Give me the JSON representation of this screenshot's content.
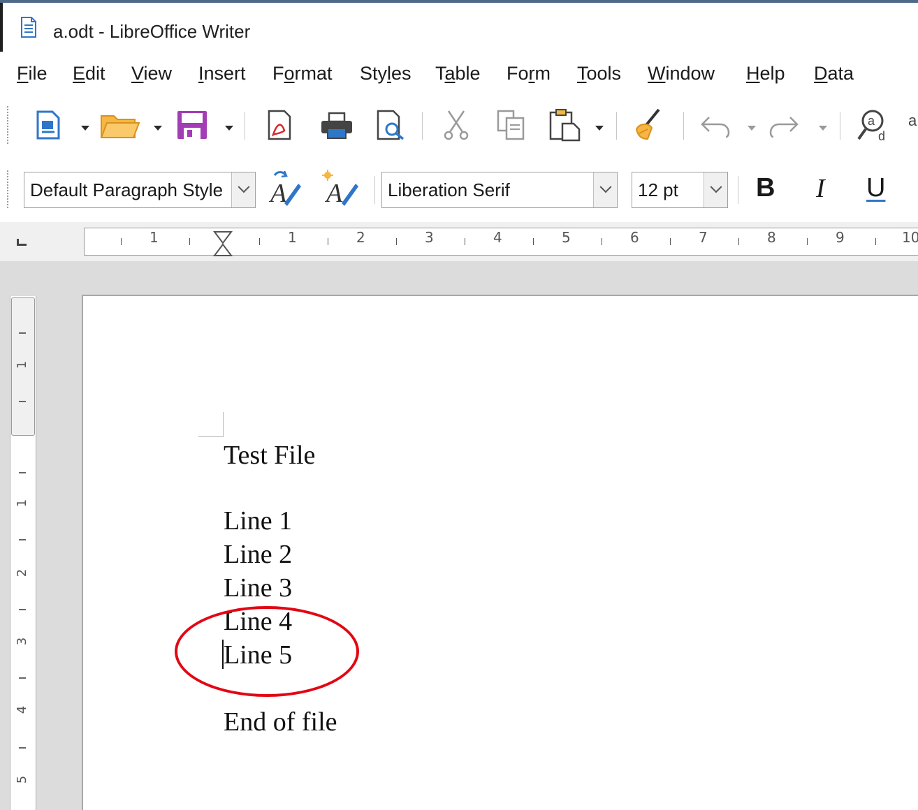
{
  "window": {
    "title": "a.odt - LibreOffice Writer",
    "icon": "writer-document-icon"
  },
  "menubar": {
    "items": [
      {
        "mnemonic": "F",
        "rest": "ile"
      },
      {
        "mnemonic": "E",
        "rest": "dit"
      },
      {
        "mnemonic": "V",
        "rest": "iew"
      },
      {
        "mnemonic": "I",
        "rest": "nsert"
      },
      {
        "pre": "F",
        "mnemonic": "o",
        "rest": "rmat"
      },
      {
        "pre": "Sty",
        "mnemonic": "l",
        "rest": "es"
      },
      {
        "pre": "T",
        "mnemonic": "a",
        "rest": "ble"
      },
      {
        "pre": "Fo",
        "mnemonic": "r",
        "rest": "m"
      },
      {
        "mnemonic": "T",
        "rest": "ools"
      },
      {
        "mnemonic": "W",
        "rest": "indow"
      },
      {
        "mnemonic": "H",
        "rest": "elp"
      },
      {
        "mnemonic": "D",
        "rest": "ata"
      }
    ]
  },
  "standard_toolbar": {
    "icons": [
      "new-document-icon",
      "open-folder-icon",
      "save-icon",
      "export-pdf-icon",
      "print-icon",
      "print-preview-icon",
      "cut-icon",
      "copy-icon",
      "paste-icon",
      "clone-formatting-icon",
      "undo-icon",
      "redo-icon",
      "find-replace-icon"
    ]
  },
  "formatting_toolbar": {
    "paragraph_style": "Default Paragraph Style",
    "font_name": "Liberation Serif",
    "font_size": "12 pt",
    "bold_label": "B",
    "italic_label": "I",
    "underline_label": "U"
  },
  "ruler": {
    "numbers": [
      "1",
      "1",
      "2",
      "3",
      "4",
      "5",
      "6",
      "7",
      "8",
      "9",
      "10"
    ]
  },
  "vertical_ruler": {
    "numbers": [
      "1",
      "1",
      "2",
      "3",
      "4",
      "5"
    ]
  },
  "document": {
    "lines": {
      "title": "Test File",
      "line1": "Line 1",
      "line2": "Line 2",
      "line3": "Line 3",
      "line4": "Line 4",
      "line5": "Line 5",
      "end": "End of file"
    }
  },
  "colors": {
    "annotation": "#e30613",
    "save_icon": "#a33db5",
    "folder_icon": "#f5b642",
    "document_icon": "#2f76c9"
  }
}
